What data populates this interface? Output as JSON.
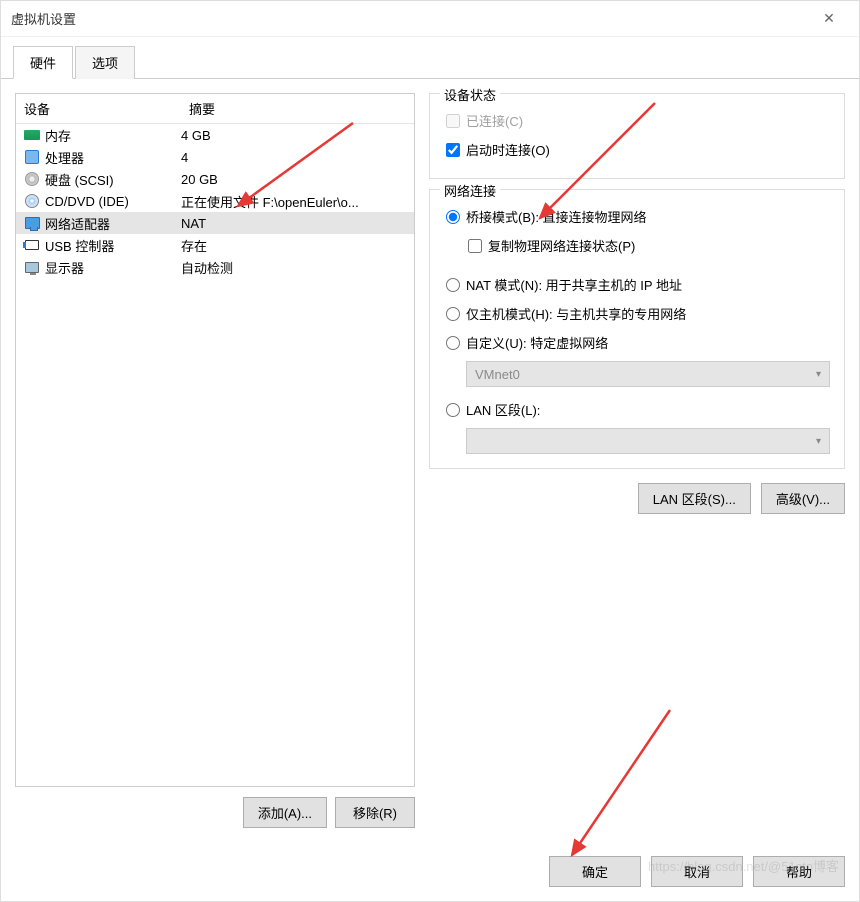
{
  "window": {
    "title": "虚拟机设置"
  },
  "tabs": {
    "hardware": "硬件",
    "options": "选项"
  },
  "table": {
    "header_device": "设备",
    "header_summary": "摘要",
    "rows": [
      {
        "icon": "memory-icon",
        "label": "内存",
        "summary": "4 GB"
      },
      {
        "icon": "cpu-icon",
        "label": "处理器",
        "summary": "4"
      },
      {
        "icon": "disk-icon",
        "label": "硬盘 (SCSI)",
        "summary": "20 GB"
      },
      {
        "icon": "cd-icon",
        "label": "CD/DVD (IDE)",
        "summary": "正在使用文件 F:\\openEuler\\o..."
      },
      {
        "icon": "network-icon",
        "label": "网络适配器",
        "summary": "NAT"
      },
      {
        "icon": "usb-icon",
        "label": "USB 控制器",
        "summary": "存在"
      },
      {
        "icon": "monitor-icon",
        "label": "显示器",
        "summary": "自动检测"
      }
    ]
  },
  "buttons": {
    "add": "添加(A)...",
    "remove": "移除(R)",
    "lan_segments": "LAN 区段(S)...",
    "advanced": "高级(V)...",
    "ok": "确定",
    "cancel": "取消",
    "help": "帮助"
  },
  "device_status": {
    "title": "设备状态",
    "connected": "已连接(C)",
    "connect_on_start": "启动时连接(O)"
  },
  "network": {
    "title": "网络连接",
    "bridged": "桥接模式(B): 直接连接物理网络",
    "replicate": "复制物理网络连接状态(P)",
    "nat": "NAT 模式(N): 用于共享主机的 IP 地址",
    "hostonly": "仅主机模式(H): 与主机共享的专用网络",
    "custom": "自定义(U): 特定虚拟网络",
    "custom_select": "VMnet0",
    "lan": "LAN 区段(L):",
    "lan_select": ""
  },
  "watermark": "https://blog.csdn.net/@51cto博客"
}
